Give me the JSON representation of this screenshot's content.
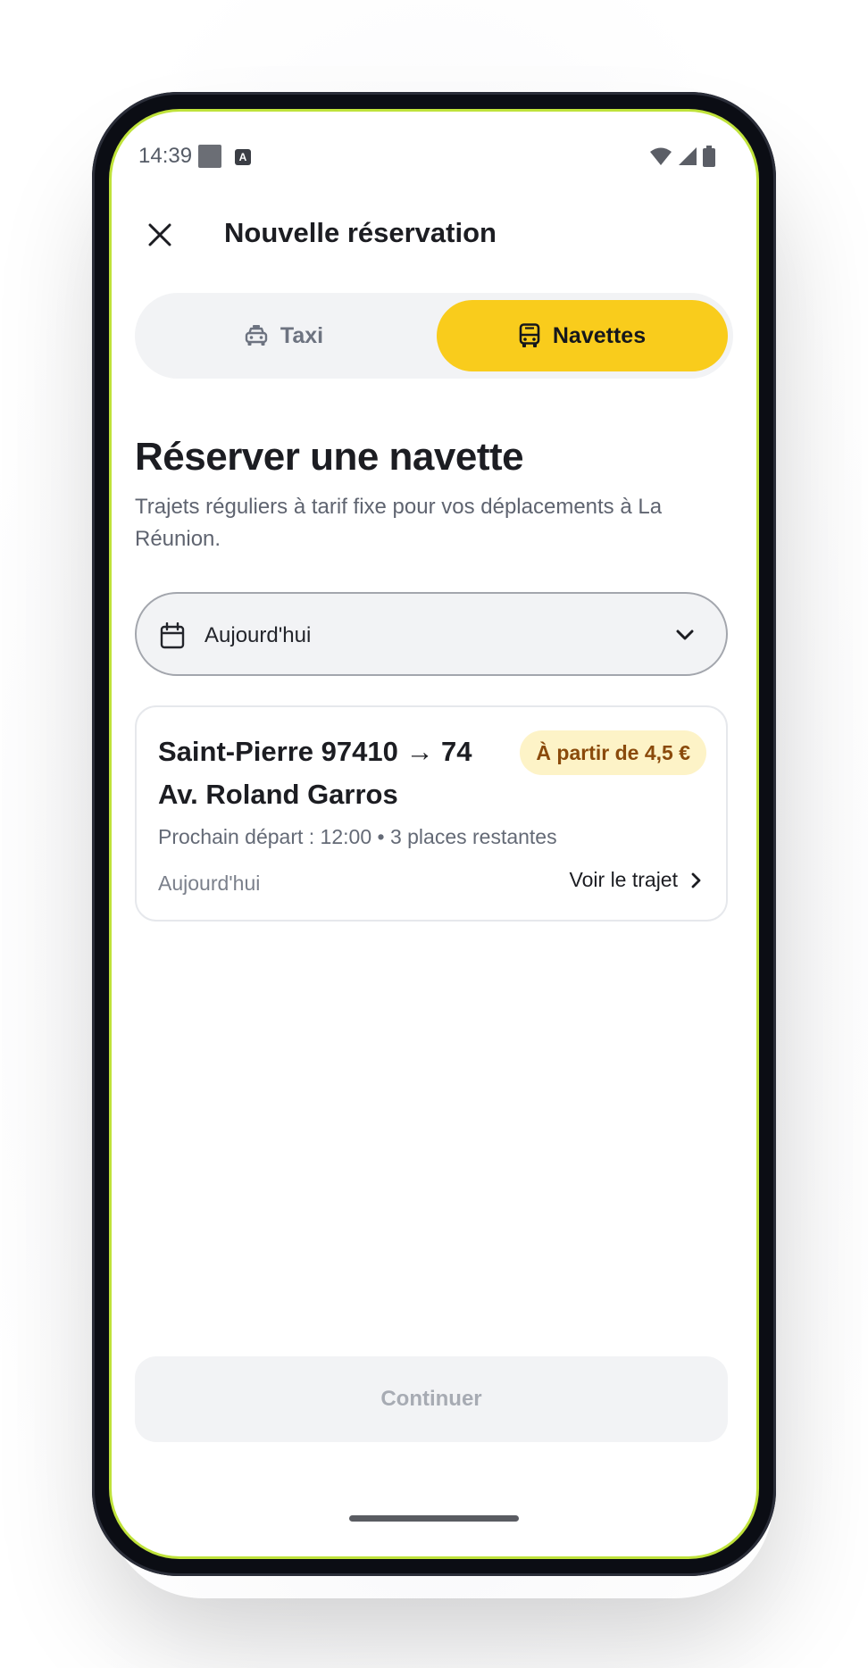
{
  "status_bar": {
    "time": "14:39",
    "notif_glyph": "A"
  },
  "header": {
    "title": "Nouvelle réservation"
  },
  "tabs": {
    "taxi_label": "Taxi",
    "navettes_label": "Navettes",
    "selected": "navettes"
  },
  "main": {
    "title": "Réserver une navette",
    "subtitle": "Trajets réguliers à tarif fixe pour vos déplacements à La Réunion."
  },
  "date_select": {
    "value": "Aujourd'hui"
  },
  "route_card": {
    "route": "Saint-Pierre 97410 → 74 Av. Roland Garros",
    "price": "À partir de 4,5 €",
    "meta": "Prochain départ : 12:00 • 3 places restantes",
    "date": "Aujourd'hui",
    "link_label": "Voir le trajet"
  },
  "footer": {
    "continue_label": "Continuer"
  },
  "colors": {
    "accent": "#f9cc1c",
    "badge_bg": "#fdf3c7",
    "badge_text": "#8a4a0b",
    "frame_outline": "#bfe23a"
  }
}
